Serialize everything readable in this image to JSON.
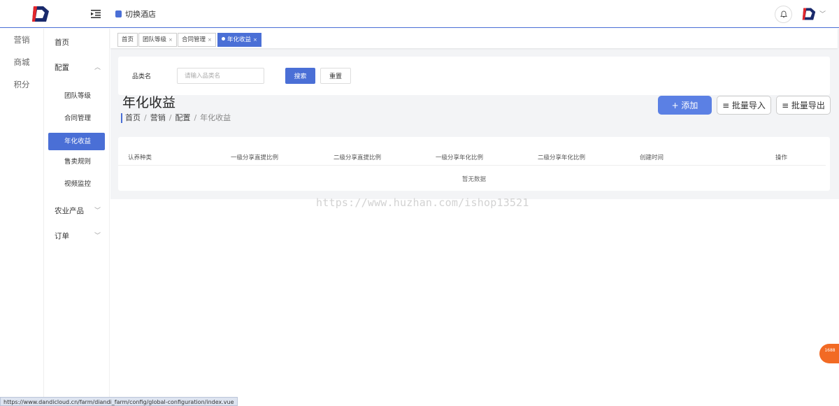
{
  "header": {
    "hotel_switch_label": "切换酒店"
  },
  "sidebar_primary": {
    "items": [
      {
        "label": "营销"
      },
      {
        "label": "商城"
      },
      {
        "label": "积分"
      }
    ]
  },
  "sidebar_secondary": {
    "home": "首页",
    "config_group": "配置",
    "config_items": [
      {
        "label": "团队等级"
      },
      {
        "label": "合同管理"
      },
      {
        "label": "年化收益"
      },
      {
        "label": "售卖规则"
      },
      {
        "label": "视频监控"
      }
    ],
    "agri_group": "农业产品",
    "order_group": "订单"
  },
  "tabs": [
    {
      "label": "首页"
    },
    {
      "label": "团队等级"
    },
    {
      "label": "合同管理"
    },
    {
      "label": "年化收益"
    }
  ],
  "search": {
    "label": "品类名",
    "placeholder": "请输入品类名",
    "search_button": "搜索",
    "reset_button": "重置"
  },
  "page": {
    "title": "年化收益",
    "breadcrumb": [
      "首页",
      "营销",
      "配置",
      "年化收益"
    ]
  },
  "actions": {
    "add": "+ 添加",
    "import": "≡ 批量导入",
    "export": "≡ 批量导出"
  },
  "table": {
    "columns": [
      "认养种类",
      "一级分享直提比例",
      "二级分享直提比例",
      "一级分享年化比例",
      "二级分享年化比例",
      "创建时间",
      "操作"
    ],
    "empty_text": "暂无数据"
  },
  "watermark": "https://www.huzhan.com/ishop13521",
  "status_url": "https://www.dandicloud.cn/farm/diandi_farm/config/global-configuration/index.vue",
  "corner_badge": "1688",
  "colors": {
    "accent": "#4a6fd6",
    "add_button": "#5b80e4",
    "badge": "#f26a24"
  }
}
